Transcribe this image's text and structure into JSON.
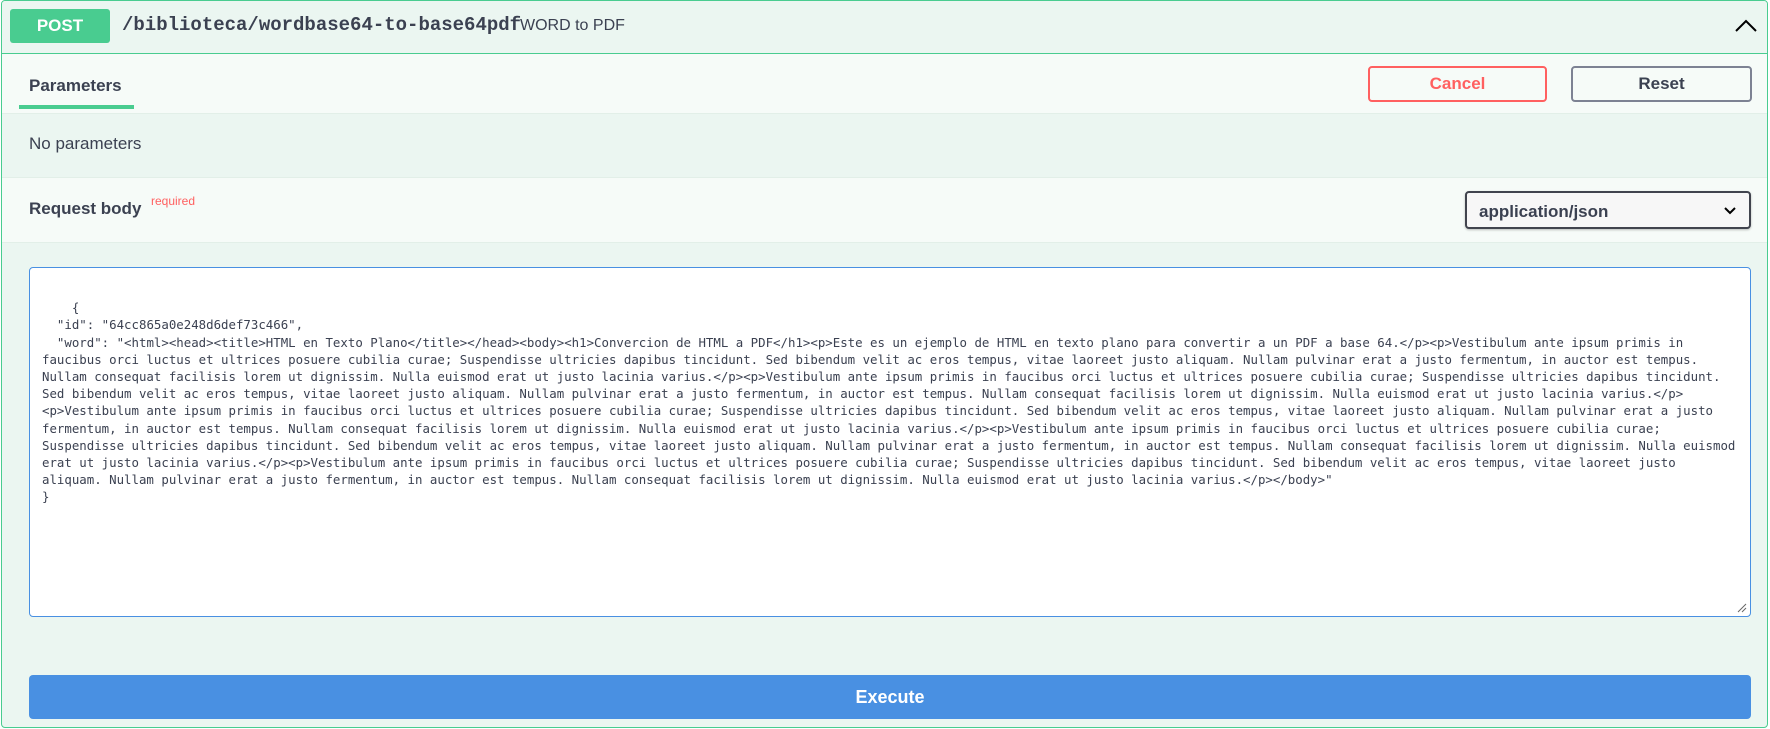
{
  "operation": {
    "method": "POST",
    "path": "/biblioteca/wordbase64-to-base64pdf",
    "description": "WORD to PDF"
  },
  "icons": {
    "collapse": "chevron-up-icon",
    "select": "chevron-down-icon",
    "resize": "resize-handle-icon"
  },
  "colors": {
    "post_accent": "#49cc90",
    "cancel": "#ff6060",
    "execute": "#4990e2"
  },
  "parameters": {
    "tab_label": "Parameters",
    "cancel_label": "Cancel",
    "reset_label": "Reset",
    "empty_text": "No parameters"
  },
  "request_body": {
    "title": "Request body",
    "required_label": "required",
    "content_type": "application/json",
    "body": "{\n  \"id\": \"64cc865a0e248d6def73c466\",\n  \"word\": \"<html><head><title>HTML en Texto Plano</title></head><body><h1>Convercion de HTML a PDF</h1><p>Este es un ejemplo de HTML en texto plano para convertir a un PDF a base 64.</p><p>Vestibulum ante ipsum primis in faucibus orci luctus et ultrices posuere cubilia curae; Suspendisse ultricies dapibus tincidunt. Sed bibendum velit ac eros tempus, vitae laoreet justo aliquam. Nullam pulvinar erat a justo fermentum, in auctor est tempus. Nullam consequat facilisis lorem ut dignissim. Nulla euismod erat ut justo lacinia varius.</p><p>Vestibulum ante ipsum primis in faucibus orci luctus et ultrices posuere cubilia curae; Suspendisse ultricies dapibus tincidunt. Sed bibendum velit ac eros tempus, vitae laoreet justo aliquam. Nullam pulvinar erat a justo fermentum, in auctor est tempus. Nullam consequat facilisis lorem ut dignissim. Nulla euismod erat ut justo lacinia varius.</p><p>Vestibulum ante ipsum primis in faucibus orci luctus et ultrices posuere cubilia curae; Suspendisse ultricies dapibus tincidunt. Sed bibendum velit ac eros tempus, vitae laoreet justo aliquam. Nullam pulvinar erat a justo fermentum, in auctor est tempus. Nullam consequat facilisis lorem ut dignissim. Nulla euismod erat ut justo lacinia varius.</p><p>Vestibulum ante ipsum primis in faucibus orci luctus et ultrices posuere cubilia curae; Suspendisse ultricies dapibus tincidunt. Sed bibendum velit ac eros tempus, vitae laoreet justo aliquam. Nullam pulvinar erat a justo fermentum, in auctor est tempus. Nullam consequat facilisis lorem ut dignissim. Nulla euismod erat ut justo lacinia varius.</p><p>Vestibulum ante ipsum primis in faucibus orci luctus et ultrices posuere cubilia curae; Suspendisse ultricies dapibus tincidunt. Sed bibendum velit ac eros tempus, vitae laoreet justo aliquam. Nullam pulvinar erat a justo fermentum, in auctor est tempus. Nullam consequat facilisis lorem ut dignissim. Nulla euismod erat ut justo lacinia varius.</p></body>\"\n}"
  },
  "execute_label": "Execute"
}
